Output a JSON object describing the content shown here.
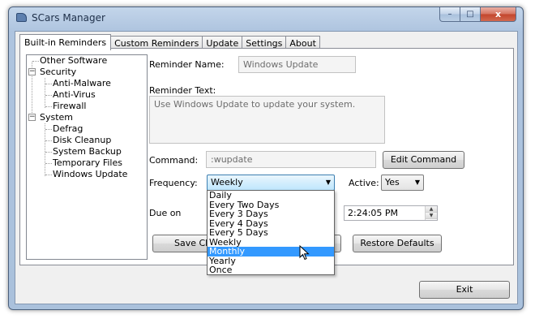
{
  "window": {
    "title": "SCars Manager",
    "icon": "car-icon"
  },
  "caption_buttons": {
    "minimize": "–",
    "maximize": "□",
    "close": "x"
  },
  "tabs": [
    {
      "label": "Built-in Reminders",
      "active": true
    },
    {
      "label": "Custom Reminders",
      "active": false
    },
    {
      "label": "Update",
      "active": false
    },
    {
      "label": "Settings",
      "active": false
    },
    {
      "label": "About",
      "active": false
    }
  ],
  "tree": {
    "nodes": [
      {
        "label": "Other Software",
        "level": 0,
        "expander": ""
      },
      {
        "label": "Security",
        "level": 0,
        "expander": "−"
      },
      {
        "label": "Anti-Malware",
        "level": 1,
        "expander": ""
      },
      {
        "label": "Anti-Virus",
        "level": 1,
        "expander": ""
      },
      {
        "label": "Firewall",
        "level": 1,
        "expander": ""
      },
      {
        "label": "System",
        "level": 0,
        "expander": "−"
      },
      {
        "label": "Defrag",
        "level": 1,
        "expander": ""
      },
      {
        "label": "Disk Cleanup",
        "level": 1,
        "expander": ""
      },
      {
        "label": "System Backup",
        "level": 1,
        "expander": ""
      },
      {
        "label": "Temporary Files",
        "level": 1,
        "expander": ""
      },
      {
        "label": "Windows Update",
        "level": 1,
        "expander": ""
      }
    ]
  },
  "form": {
    "reminder_name_label": "Reminder Name:",
    "reminder_name_value": "Windows Update",
    "reminder_text_label": "Reminder Text:",
    "reminder_text_value": "Use Windows Update to update your system.",
    "command_label": "Command:",
    "command_value": ":wupdate",
    "edit_command_button": "Edit Command",
    "frequency_label": "Frequency:",
    "frequency_value": "Weekly",
    "active_label": "Active:",
    "active_value": "Yes",
    "due_on_label": "Due on",
    "due_time_value": "2:24:05 PM",
    "save_button": "Save Changes",
    "restore_button": "Restore Defaults"
  },
  "frequency_options": [
    "Daily",
    "Every Two Days",
    "Every 3 Days",
    "Every 4 Days",
    "Every 5 Days",
    "Weekly",
    "Monthly",
    "Yearly",
    "Once"
  ],
  "frequency_highlighted": "Monthly",
  "exit_button": "Exit",
  "colors": {
    "highlight": "#3399ff",
    "window_frame": "#aac1dc"
  }
}
